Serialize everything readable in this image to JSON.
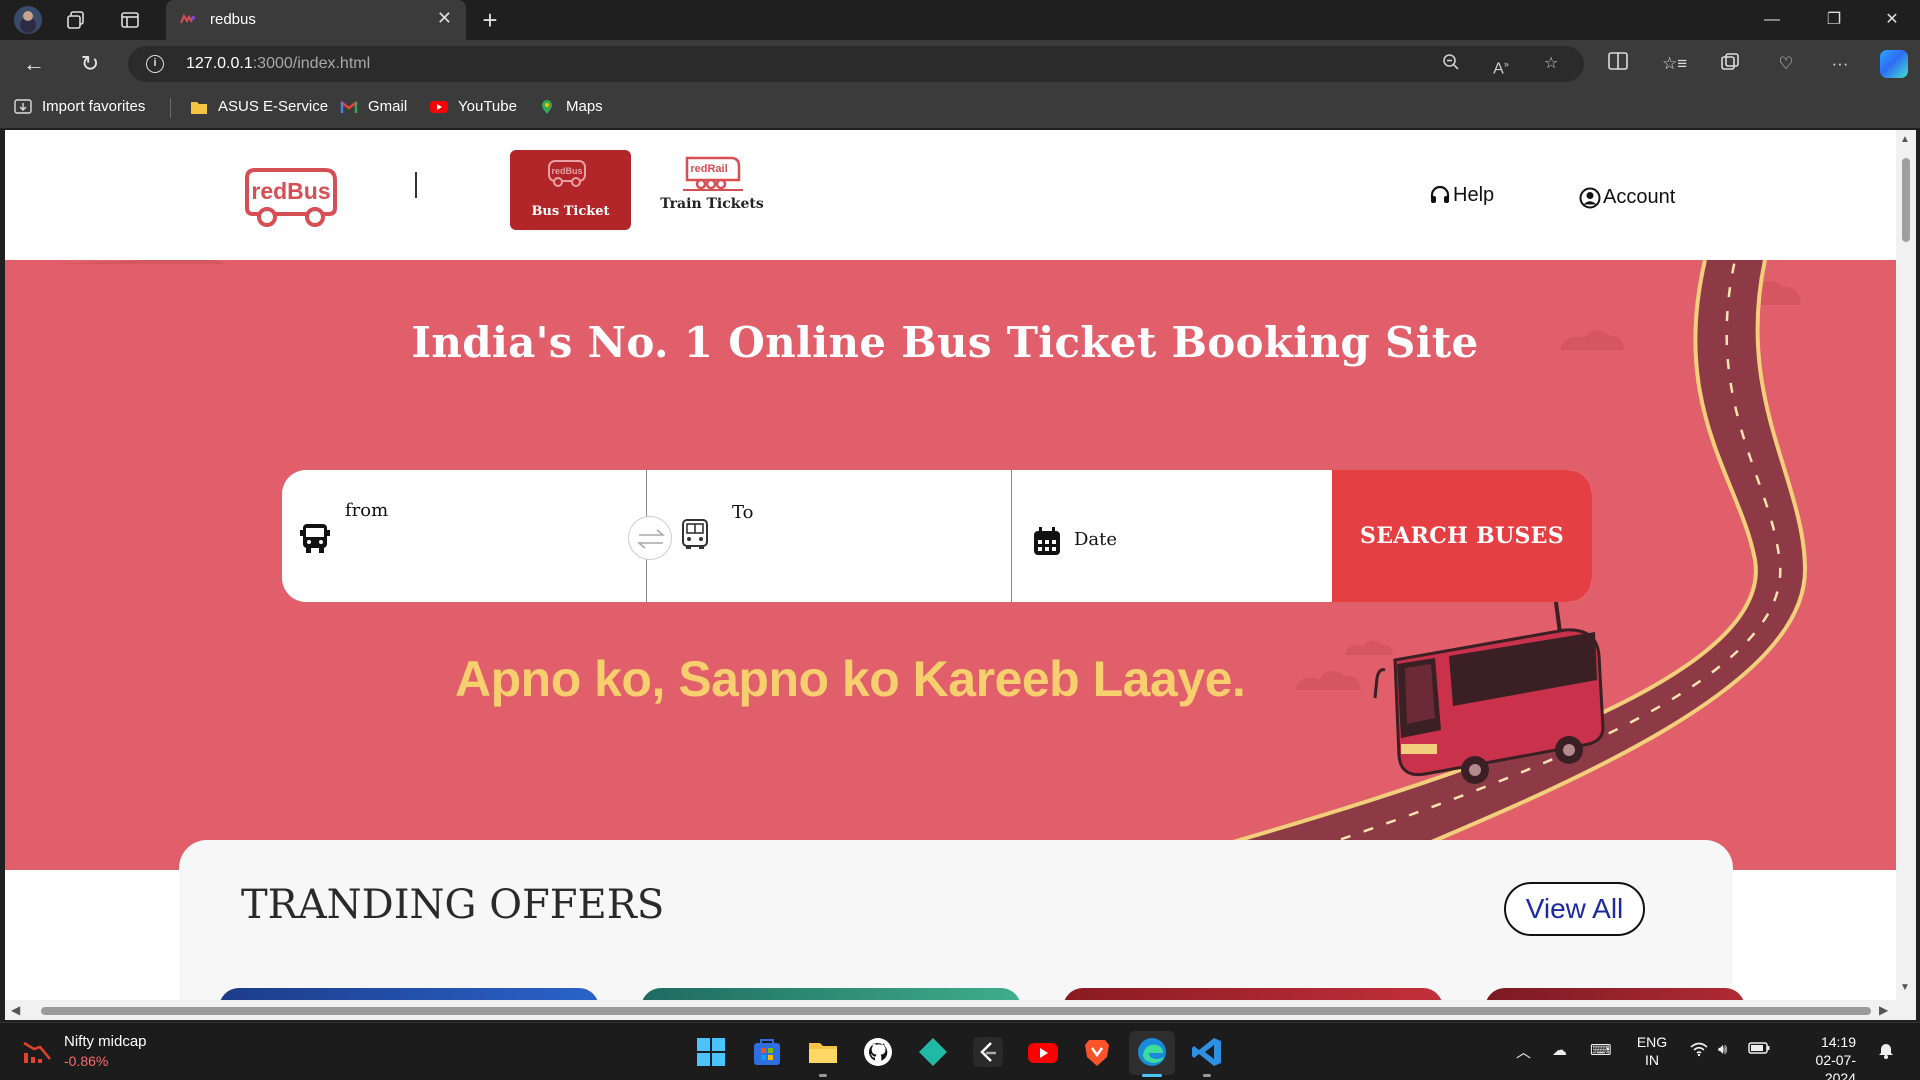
{
  "browser": {
    "tab_title": "redbus",
    "url_host": "127.0.0.1",
    "url_path": ":3000/index.html",
    "favorites": [
      {
        "label": "Import favorites"
      },
      {
        "label": "ASUS E-Service"
      },
      {
        "label": "Gmail"
      },
      {
        "label": "YouTube"
      },
      {
        "label": "Maps"
      }
    ]
  },
  "site": {
    "nav": {
      "bus_ticket": "Bus Ticket",
      "train_tickets": "Train Tickets",
      "help": "Help",
      "account": "Account"
    },
    "hero": {
      "title": "India's No. 1 Online Bus Ticket Booking Site",
      "tagline": "Apno ko, Sapno ko Kareeb Laaye."
    },
    "search": {
      "from_label": "from",
      "to_label": "To",
      "date_label": "Date",
      "button_label": "SEARCH BUSES"
    },
    "offers": {
      "title": "TRANDING OFFERS",
      "view_all": "View All"
    }
  },
  "taskbar": {
    "widget_name": "Nifty midcap",
    "widget_value": "-0.86%",
    "lang_line1": "ENG",
    "lang_line2": "IN",
    "time": "14:19",
    "date": "02-07-2024"
  },
  "colors": {
    "brand_red": "#d84e55",
    "hero_bg": "#e15f6a",
    "search_button": "#e53f43",
    "tagline": "#f7cf6e"
  }
}
